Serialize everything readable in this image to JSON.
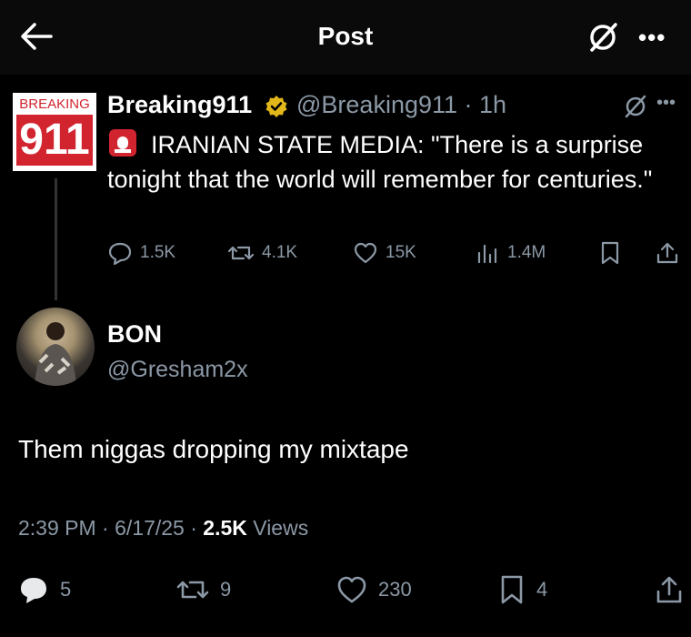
{
  "header": {
    "title": "Post",
    "back_icon": "arrow-left-icon",
    "grok_icon": "grok-icon",
    "more_label": "•••"
  },
  "quoted": {
    "avatar_top_text": "BREAKING",
    "avatar_number": "911",
    "name": "Breaking911",
    "handle_time": "@Breaking911 · 1h",
    "verified_icon": "verified-badge-icon",
    "more_label": "•••",
    "text_line1": "IRANIAN STATE MEDIA: \"There is a surprise",
    "text_line2": "tonight that the world will remember for centuries.\"",
    "stats": {
      "replies": "1.5K",
      "reposts": "4.1K",
      "likes": "15K",
      "views": "1.4M"
    }
  },
  "post": {
    "name": "BON",
    "handle": "@Gresham2x",
    "text": "Them niggas dropping my mixtape",
    "timestamp": "2:39 PM · 6/17/25 · ",
    "views_count": "2.5K",
    "views_label": " Views",
    "stats": {
      "replies": "5",
      "reposts": "9",
      "likes": "230",
      "bookmarks": "4"
    }
  },
  "colors": {
    "background": "#000000",
    "text": "#e7e9ea",
    "muted": "#8b98a5",
    "brand_red": "#d1242f",
    "verified_gold": "#e2b719"
  }
}
